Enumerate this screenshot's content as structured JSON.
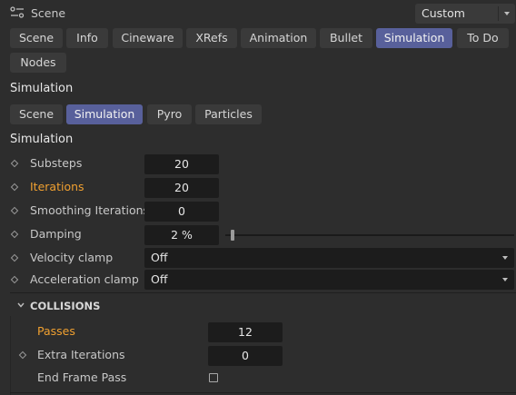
{
  "header": {
    "title": "Scene",
    "preset": "Custom"
  },
  "main_tabs": [
    "Scene",
    "Info",
    "Cineware",
    "XRefs",
    "Animation",
    "Bullet",
    "Simulation",
    "To Do",
    "Nodes"
  ],
  "main_tabs_active": "Simulation",
  "section1_title": "Simulation",
  "sub_tabs": [
    "Scene",
    "Simulation",
    "Pyro",
    "Particles"
  ],
  "sub_tabs_active": "Simulation",
  "section2_title": "Simulation",
  "params": {
    "substeps": {
      "label": "Substeps",
      "value": "20"
    },
    "iterations": {
      "label": "Iterations",
      "value": "20"
    },
    "smoothing": {
      "label": "Smoothing Iterations",
      "value": "0"
    },
    "damping": {
      "label": "Damping",
      "value": "2 %",
      "level": 0.02
    },
    "velocity_clamp": {
      "label": "Velocity clamp",
      "value": "Off"
    },
    "acceleration_clamp": {
      "label": "Acceleration clamp",
      "value": "Off"
    }
  },
  "collisions": {
    "title": "COLLISIONS",
    "passes": {
      "label": "Passes",
      "value": "12"
    },
    "extra_iterations": {
      "label": "Extra Iterations",
      "value": "0"
    },
    "end_frame_pass": {
      "label": "End Frame Pass",
      "checked": false
    }
  },
  "colors": {
    "accent": "#58609b",
    "highlight_label": "#f0a030",
    "background": "#2d2d2d"
  }
}
